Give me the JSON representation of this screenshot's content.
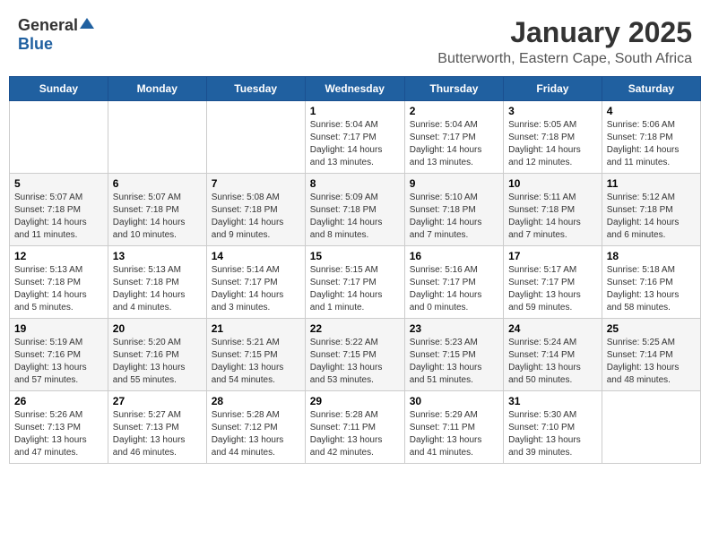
{
  "logo": {
    "general": "General",
    "blue": "Blue"
  },
  "title": "January 2025",
  "location": "Butterworth, Eastern Cape, South Africa",
  "days_of_week": [
    "Sunday",
    "Monday",
    "Tuesday",
    "Wednesday",
    "Thursday",
    "Friday",
    "Saturday"
  ],
  "weeks": [
    [
      {
        "day": "",
        "info": ""
      },
      {
        "day": "",
        "info": ""
      },
      {
        "day": "",
        "info": ""
      },
      {
        "day": "1",
        "info": "Sunrise: 5:04 AM\nSunset: 7:17 PM\nDaylight: 14 hours\nand 13 minutes."
      },
      {
        "day": "2",
        "info": "Sunrise: 5:04 AM\nSunset: 7:17 PM\nDaylight: 14 hours\nand 13 minutes."
      },
      {
        "day": "3",
        "info": "Sunrise: 5:05 AM\nSunset: 7:18 PM\nDaylight: 14 hours\nand 12 minutes."
      },
      {
        "day": "4",
        "info": "Sunrise: 5:06 AM\nSunset: 7:18 PM\nDaylight: 14 hours\nand 11 minutes."
      }
    ],
    [
      {
        "day": "5",
        "info": "Sunrise: 5:07 AM\nSunset: 7:18 PM\nDaylight: 14 hours\nand 11 minutes."
      },
      {
        "day": "6",
        "info": "Sunrise: 5:07 AM\nSunset: 7:18 PM\nDaylight: 14 hours\nand 10 minutes."
      },
      {
        "day": "7",
        "info": "Sunrise: 5:08 AM\nSunset: 7:18 PM\nDaylight: 14 hours\nand 9 minutes."
      },
      {
        "day": "8",
        "info": "Sunrise: 5:09 AM\nSunset: 7:18 PM\nDaylight: 14 hours\nand 8 minutes."
      },
      {
        "day": "9",
        "info": "Sunrise: 5:10 AM\nSunset: 7:18 PM\nDaylight: 14 hours\nand 7 minutes."
      },
      {
        "day": "10",
        "info": "Sunrise: 5:11 AM\nSunset: 7:18 PM\nDaylight: 14 hours\nand 7 minutes."
      },
      {
        "day": "11",
        "info": "Sunrise: 5:12 AM\nSunset: 7:18 PM\nDaylight: 14 hours\nand 6 minutes."
      }
    ],
    [
      {
        "day": "12",
        "info": "Sunrise: 5:13 AM\nSunset: 7:18 PM\nDaylight: 14 hours\nand 5 minutes."
      },
      {
        "day": "13",
        "info": "Sunrise: 5:13 AM\nSunset: 7:18 PM\nDaylight: 14 hours\nand 4 minutes."
      },
      {
        "day": "14",
        "info": "Sunrise: 5:14 AM\nSunset: 7:17 PM\nDaylight: 14 hours\nand 3 minutes."
      },
      {
        "day": "15",
        "info": "Sunrise: 5:15 AM\nSunset: 7:17 PM\nDaylight: 14 hours\nand 1 minute."
      },
      {
        "day": "16",
        "info": "Sunrise: 5:16 AM\nSunset: 7:17 PM\nDaylight: 14 hours\nand 0 minutes."
      },
      {
        "day": "17",
        "info": "Sunrise: 5:17 AM\nSunset: 7:17 PM\nDaylight: 13 hours\nand 59 minutes."
      },
      {
        "day": "18",
        "info": "Sunrise: 5:18 AM\nSunset: 7:16 PM\nDaylight: 13 hours\nand 58 minutes."
      }
    ],
    [
      {
        "day": "19",
        "info": "Sunrise: 5:19 AM\nSunset: 7:16 PM\nDaylight: 13 hours\nand 57 minutes."
      },
      {
        "day": "20",
        "info": "Sunrise: 5:20 AM\nSunset: 7:16 PM\nDaylight: 13 hours\nand 55 minutes."
      },
      {
        "day": "21",
        "info": "Sunrise: 5:21 AM\nSunset: 7:15 PM\nDaylight: 13 hours\nand 54 minutes."
      },
      {
        "day": "22",
        "info": "Sunrise: 5:22 AM\nSunset: 7:15 PM\nDaylight: 13 hours\nand 53 minutes."
      },
      {
        "day": "23",
        "info": "Sunrise: 5:23 AM\nSunset: 7:15 PM\nDaylight: 13 hours\nand 51 minutes."
      },
      {
        "day": "24",
        "info": "Sunrise: 5:24 AM\nSunset: 7:14 PM\nDaylight: 13 hours\nand 50 minutes."
      },
      {
        "day": "25",
        "info": "Sunrise: 5:25 AM\nSunset: 7:14 PM\nDaylight: 13 hours\nand 48 minutes."
      }
    ],
    [
      {
        "day": "26",
        "info": "Sunrise: 5:26 AM\nSunset: 7:13 PM\nDaylight: 13 hours\nand 47 minutes."
      },
      {
        "day": "27",
        "info": "Sunrise: 5:27 AM\nSunset: 7:13 PM\nDaylight: 13 hours\nand 46 minutes."
      },
      {
        "day": "28",
        "info": "Sunrise: 5:28 AM\nSunset: 7:12 PM\nDaylight: 13 hours\nand 44 minutes."
      },
      {
        "day": "29",
        "info": "Sunrise: 5:28 AM\nSunset: 7:11 PM\nDaylight: 13 hours\nand 42 minutes."
      },
      {
        "day": "30",
        "info": "Sunrise: 5:29 AM\nSunset: 7:11 PM\nDaylight: 13 hours\nand 41 minutes."
      },
      {
        "day": "31",
        "info": "Sunrise: 5:30 AM\nSunset: 7:10 PM\nDaylight: 13 hours\nand 39 minutes."
      },
      {
        "day": "",
        "info": ""
      }
    ]
  ]
}
